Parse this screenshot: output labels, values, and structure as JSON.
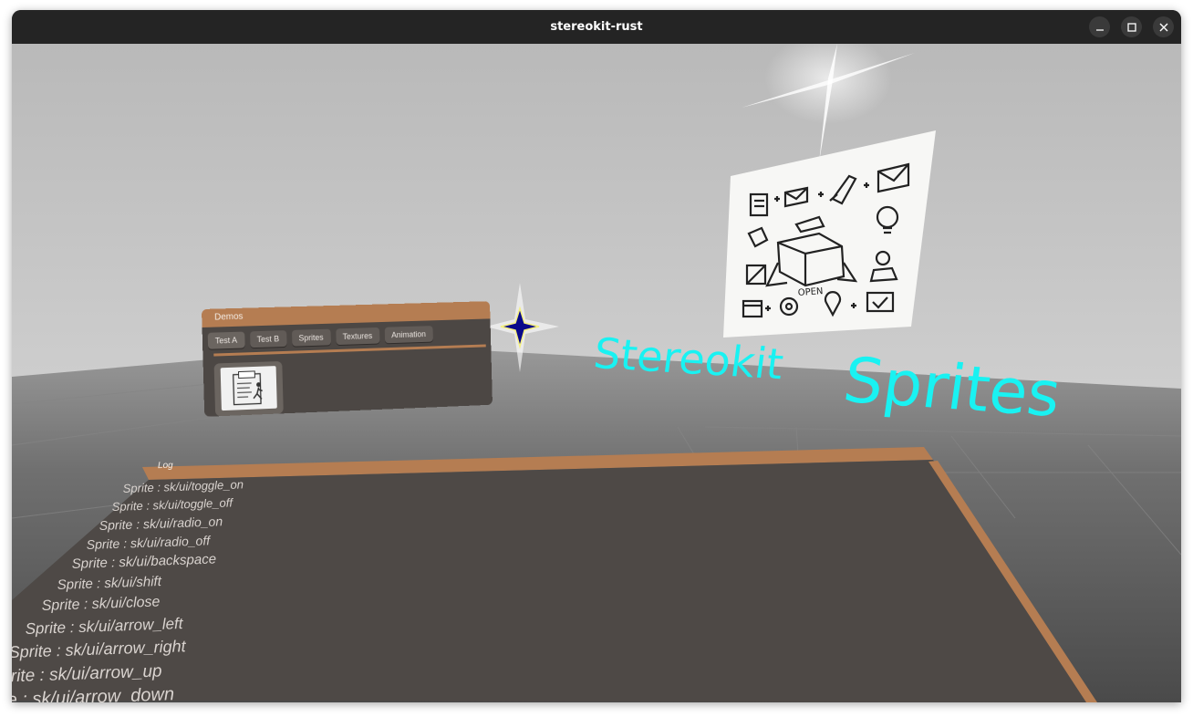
{
  "window": {
    "title": "stereokit-rust",
    "controls": [
      "minimize-icon",
      "maximize-icon",
      "close-icon"
    ]
  },
  "scene": {
    "title_text_1": "Stereokit",
    "title_text_2": "Sprites",
    "title_color": "#19f2f2"
  },
  "demos_panel": {
    "title": "Demos",
    "tabs": [
      {
        "label": "Test A"
      },
      {
        "label": "Test B"
      },
      {
        "label": "Sprites"
      },
      {
        "label": "Textures"
      },
      {
        "label": "Animation"
      }
    ],
    "sprite_icon": "exit-sign-icon"
  },
  "log_panel": {
    "title": "Log",
    "lines": [
      "Sprite : sk/ui/toggle_on",
      "Sprite : sk/ui/toggle_off",
      "Sprite : sk/ui/radio_on",
      "Sprite : sk/ui/radio_off",
      "Sprite : sk/ui/backspace",
      "Sprite : sk/ui/shift",
      "Sprite : sk/ui/close",
      "Sprite : sk/ui/arrow_left",
      "Sprite : sk/ui/arrow_right",
      "Sprite : sk/ui/arrow_up",
      "Sprite : sk/ui/arrow_down"
    ]
  },
  "sprite_board": {
    "label": "OPEN",
    "icons": [
      "clipboard-icon",
      "envelope-icon",
      "rocket-icon",
      "mail-icon",
      "tag-icon",
      "lightbulb-icon",
      "open-box-icon",
      "person-icon",
      "crop-icon",
      "calendar-icon",
      "gear-icon",
      "location-pin-icon",
      "checkbox-icon"
    ]
  },
  "colors": {
    "accent": "#b57d52",
    "panel": "#4c4744",
    "titlebar": "#242424"
  }
}
